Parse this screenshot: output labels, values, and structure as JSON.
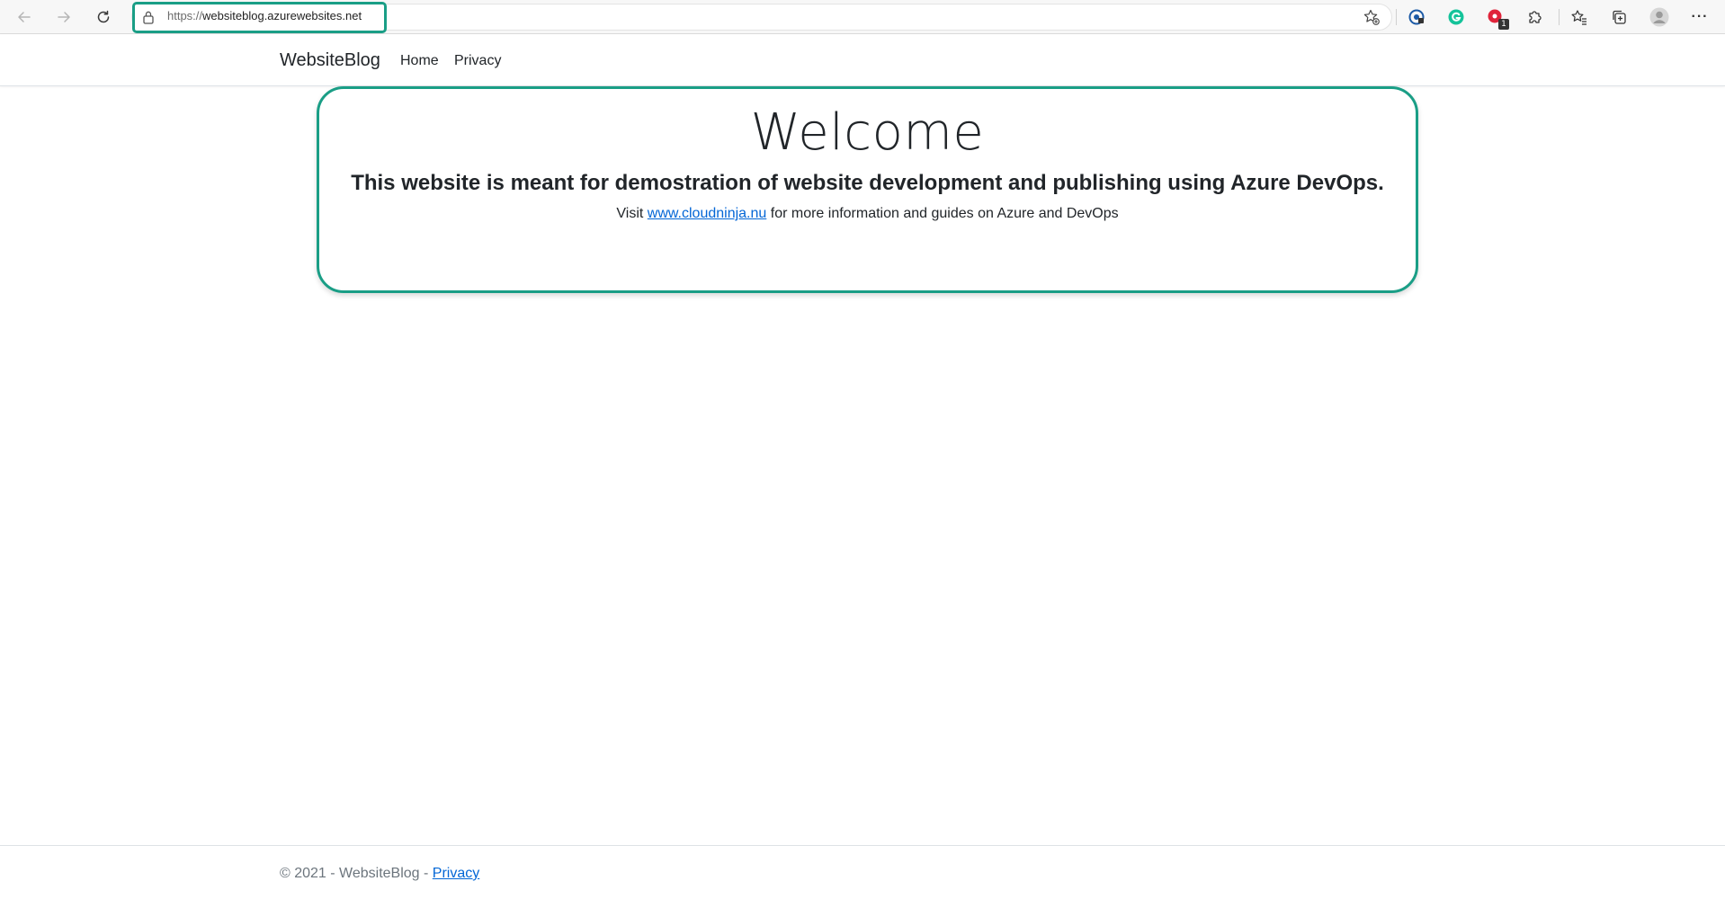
{
  "browser": {
    "url_scheme": "https://",
    "url_host": "websiteblog.azurewebsites.net",
    "icons": {
      "back": "arrow-left-icon",
      "forward": "arrow-right-icon",
      "refresh": "refresh-icon",
      "lock": "lock-icon",
      "favorite": "star-add-icon",
      "extensions": [
        "copilot-extension-icon",
        "grammarly-extension-icon",
        "red-extension-icon",
        "puzzle-icon"
      ],
      "favorites": "favorites-icon",
      "collections": "collections-icon",
      "profile": "profile-icon",
      "menu": "more-icon"
    },
    "extension_badge": "1",
    "menu_glyph": "···"
  },
  "navbar": {
    "brand": "WebsiteBlog",
    "links": [
      "Home",
      "Privacy"
    ]
  },
  "welcome": {
    "title": "Welcome",
    "subtitle": "This website is meant for demostration of website development and publishing using Azure DevOps.",
    "visit_prefix": "Visit ",
    "link_text": "www.cloudninja.nu",
    "visit_suffix": " for more information and guides on Azure and DevOps"
  },
  "footer": {
    "text": "© 2021 - WebsiteBlog - ",
    "link": "Privacy"
  },
  "colors": {
    "highlight": "#1a9e86",
    "link": "#0366d6",
    "grammarly": "#15c39a",
    "red_extension": "#e0243a"
  }
}
